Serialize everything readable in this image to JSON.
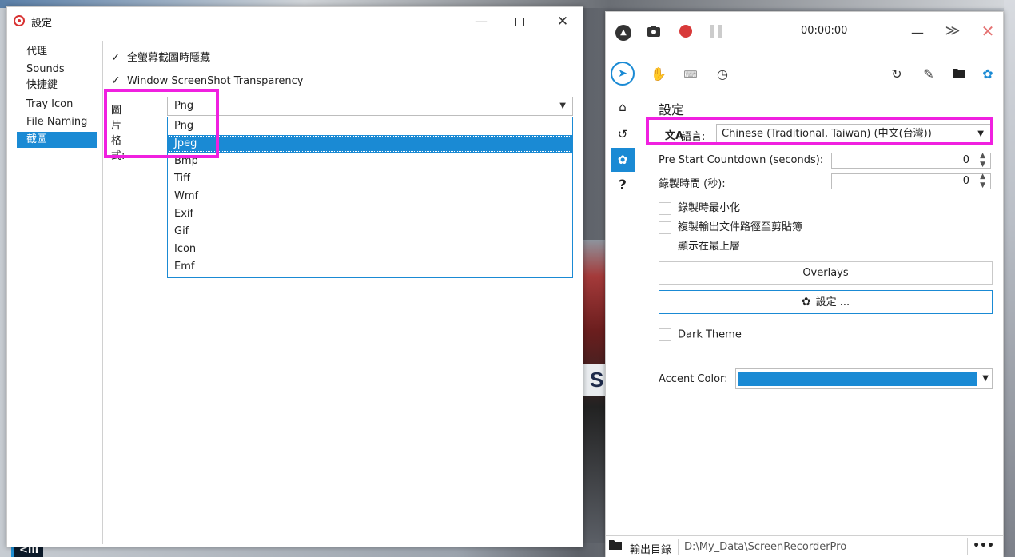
{
  "settings_window": {
    "title": "設定",
    "controls": {
      "minimize": "—",
      "maximize": "",
      "close": "✕"
    },
    "nav": [
      {
        "label": "代理"
      },
      {
        "label": "Sounds"
      },
      {
        "label": "快捷鍵"
      },
      {
        "label": "Tray Icon"
      },
      {
        "label": "File Naming"
      },
      {
        "label": "截圖",
        "selected": true
      }
    ],
    "checkboxes": [
      {
        "label": "全螢幕截圖時隱藏",
        "checked": true
      },
      {
        "label": "Window ScreenShot Transparency",
        "checked": true
      }
    ],
    "image_format": {
      "label": "圖片格式:",
      "value": "Png",
      "options": [
        "Png",
        "Jpeg",
        "Bmp",
        "Tiff",
        "Wmf",
        "Exif",
        "Gif",
        "Icon",
        "Emf"
      ],
      "highlighted_option": "Jpeg"
    },
    "check_glyph": "✓",
    "arrow_glyph": "▼"
  },
  "recorder_window": {
    "timer": "00:00:00",
    "toolbar_icons": [
      "home-icon",
      "camera-icon",
      "record-icon",
      "pause-icon",
      "minimize-icon",
      "collapse-icon",
      "close-icon"
    ],
    "tools": [
      "pointer-icon",
      "hand-icon",
      "keyboard-icon",
      "timer-icon",
      "refresh-icon",
      "brush-icon",
      "folder-icon",
      "gear-icon"
    ],
    "vnav": [
      "home-icon",
      "history-icon",
      "gear-icon",
      "help-icon"
    ],
    "vnav_help_glyph": "?",
    "panel_title": "設定",
    "language": {
      "label": "語言:",
      "value": "Chinese (Traditional, Taiwan) (中文(台灣))"
    },
    "pre_start_countdown": {
      "label": "Pre Start Countdown (seconds):",
      "value": "0"
    },
    "record_duration": {
      "label": "錄製時間 (秒):",
      "value": "0"
    },
    "options": [
      {
        "label": "錄製時最小化",
        "checked": false
      },
      {
        "label": "複製輸出文件路徑至剪貼簿",
        "checked": false
      },
      {
        "label": "顯示在最上層",
        "checked": false
      }
    ],
    "overlays_button": "Overlays",
    "settings_button": "設定 ...",
    "dark_theme": {
      "label": "Dark Theme",
      "checked": false
    },
    "accent_color": {
      "label": "Accent Color:",
      "color": "#1a8ad4"
    },
    "statusbar": {
      "label": "輸出目錄",
      "path": "D:\\My_Data\\ScreenRecorderPro",
      "more": "•••"
    }
  },
  "desktop": {
    "badge_text": "S",
    "taskbar_text": "<ill"
  },
  "colors": {
    "accent": "#1a8ad4",
    "highlight": "#f020e0",
    "record": "#d83a3a"
  }
}
